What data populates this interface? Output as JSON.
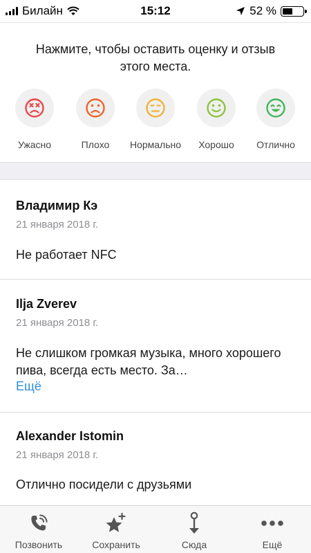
{
  "status_bar": {
    "carrier": "Билайн",
    "time": "15:12",
    "battery_text": "52 %",
    "battery_level": 0.52
  },
  "rating": {
    "prompt": "Нажмите, чтобы оставить оценку и отзыв этого места.",
    "options": [
      {
        "label": "Ужасно",
        "color": "#e8474a",
        "icon": "terrible-face-icon"
      },
      {
        "label": "Плохо",
        "color": "#f0632e",
        "icon": "bad-face-icon"
      },
      {
        "label": "Нормально",
        "color": "#f0b33c",
        "icon": "neutral-face-icon"
      },
      {
        "label": "Хорошо",
        "color": "#8cc43f",
        "icon": "good-face-icon"
      },
      {
        "label": "Отлично",
        "color": "#44b55a",
        "icon": "excellent-face-icon"
      }
    ]
  },
  "reviews": [
    {
      "author": "Владимир Кэ",
      "date": "21 января 2018 г.",
      "text": "Не работает NFC"
    },
    {
      "author": "Ilja Zverev",
      "date": "21 января 2018 г.",
      "text": "Не слишком громкая музыка, много хорошего пива, всегда есть место. За…",
      "more": "Ещё"
    },
    {
      "author": "Alexander Istomin",
      "date": "21 января 2018 г.",
      "text": "Отлично посидели с друзьями"
    }
  ],
  "tab_bar": {
    "tabs": [
      {
        "label": "Позвонить",
        "icon": "phone-icon"
      },
      {
        "label": "Сохранить",
        "icon": "star-plus-icon"
      },
      {
        "label": "Сюда",
        "icon": "pin-arrow-icon"
      },
      {
        "label": "Ещё",
        "icon": "more-dots-icon"
      }
    ]
  }
}
